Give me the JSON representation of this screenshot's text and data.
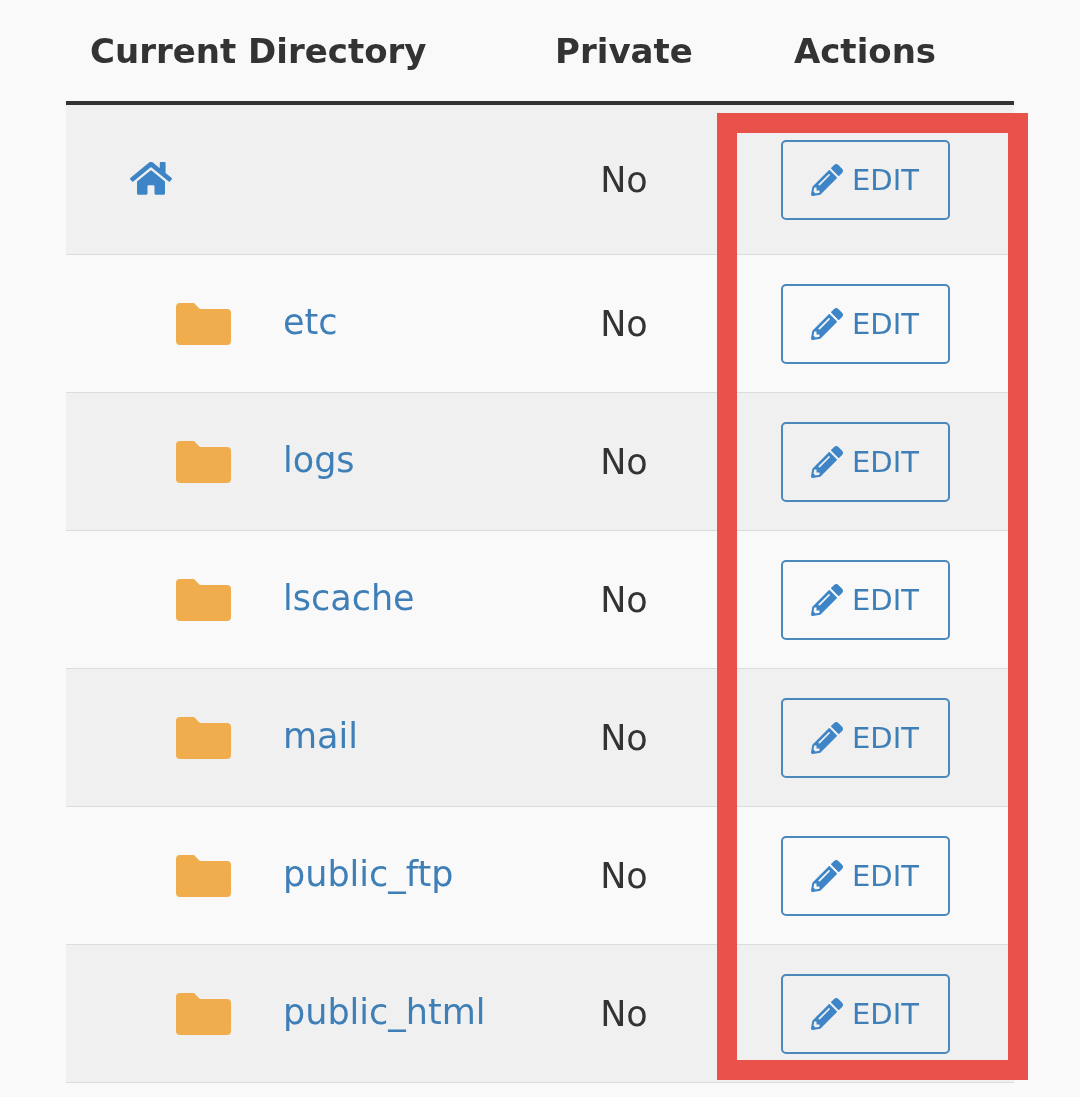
{
  "table": {
    "columns": [
      {
        "label": "Current Directory",
        "highlighted": false
      },
      {
        "label": "Private",
        "highlighted": false
      },
      {
        "label": "Actions",
        "highlighted": true
      }
    ],
    "rows": [
      {
        "kind": "home",
        "private": "No",
        "action": "EDIT"
      },
      {
        "kind": "folder",
        "name": "etc",
        "private": "No",
        "action": "EDIT"
      },
      {
        "kind": "folder",
        "name": "logs",
        "private": "No",
        "action": "EDIT"
      },
      {
        "kind": "folder",
        "name": "lscache",
        "private": "No",
        "action": "EDIT"
      },
      {
        "kind": "folder",
        "name": "mail",
        "private": "No",
        "action": "EDIT"
      },
      {
        "kind": "folder",
        "name": "public_ftp",
        "private": "No",
        "action": "EDIT"
      },
      {
        "kind": "folder",
        "name": "public_html",
        "private": "No",
        "action": "EDIT"
      }
    ]
  }
}
